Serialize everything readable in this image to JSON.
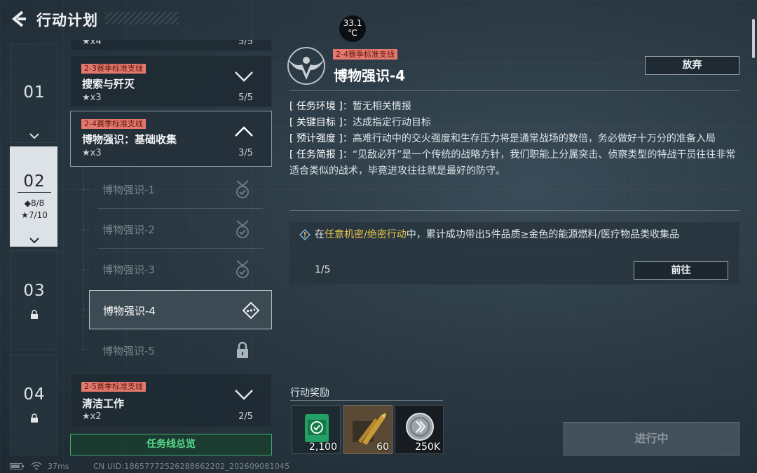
{
  "header": {
    "title": "行动计划"
  },
  "hud": {
    "temperature": "33.1",
    "temperature_unit": "℃"
  },
  "chapters": [
    {
      "number": "01",
      "state": "normal"
    },
    {
      "number": "02",
      "state": "active",
      "diamonds": "◆8/8",
      "stars": "★7/10"
    },
    {
      "number": "03",
      "state": "locked"
    },
    {
      "number": "04",
      "state": "locked"
    }
  ],
  "quest_list": {
    "top_partial": {
      "stars": "★x4",
      "progress": "5/5"
    },
    "cards": [
      {
        "tag": "2-3赛季标准支线",
        "name": "搜索与歼灭",
        "stars": "★x3",
        "progress": "5/5",
        "expanded": false
      },
      {
        "tag": "2-4赛季标准支线",
        "name": "博物强识：基础收集",
        "stars": "★x3",
        "progress": "3/5",
        "expanded": true
      },
      {
        "tag": "2-5赛季标准支线",
        "name": "清洁工作",
        "stars": "★x2",
        "progress": "2/5",
        "expanded": false
      }
    ],
    "sub_tasks": [
      {
        "label": "博物强识-1",
        "state": "completed"
      },
      {
        "label": "博物强识-2",
        "state": "completed"
      },
      {
        "label": "博物强识-3",
        "state": "completed"
      },
      {
        "label": "博物强识-4",
        "state": "selected"
      },
      {
        "label": "博物强识-5",
        "state": "locked"
      }
    ],
    "overview_button": "任务线总览"
  },
  "detail": {
    "tag": "2-4赛季标准支线",
    "title": "博物强识-4",
    "abandon_button": "放弃",
    "info": [
      {
        "key": "[ 任务环境 ]",
        "value": "：暂无相关情报"
      },
      {
        "key": "[ 关键目标 ]",
        "value": "：达成指定行动目标"
      },
      {
        "key": "[ 预计强度 ]",
        "value": "：高难行动中的交火强度和生存压力将是通常战场的数倍，务必做好十万分的准备入局"
      },
      {
        "key": "[ 任务简报 ]",
        "value": "：“见敌必歼”是一个传统的战略方针，我们职能上分属突击、侦察类型的特战干员往往非常适合类似的战术，毕竟进攻往往就是最好的防守。"
      }
    ],
    "objective": {
      "prefix": "在",
      "highlight": "任意机密/绝密行动",
      "suffix": "中，累计成功带出5件品质≥金色的能源燃料/医疗物品类收集品",
      "progress": "1/5",
      "goto_button": "前往"
    },
    "rewards_label": "行动奖励",
    "rewards": [
      {
        "icon": "green-supply-icon",
        "quantity": "2,100"
      },
      {
        "icon": "ammo-box-icon",
        "quantity": "60"
      },
      {
        "icon": "silver-coin-icon",
        "quantity": "250K"
      }
    ],
    "status_button": "进行中"
  },
  "footer": {
    "ping": "37ms",
    "uid": "CN UID:1865777252628866220​2_202609081045"
  },
  "colors": {
    "tag_bg": "#e5786c",
    "highlight": "#e4c04c",
    "overview_green": "#55d98a"
  }
}
